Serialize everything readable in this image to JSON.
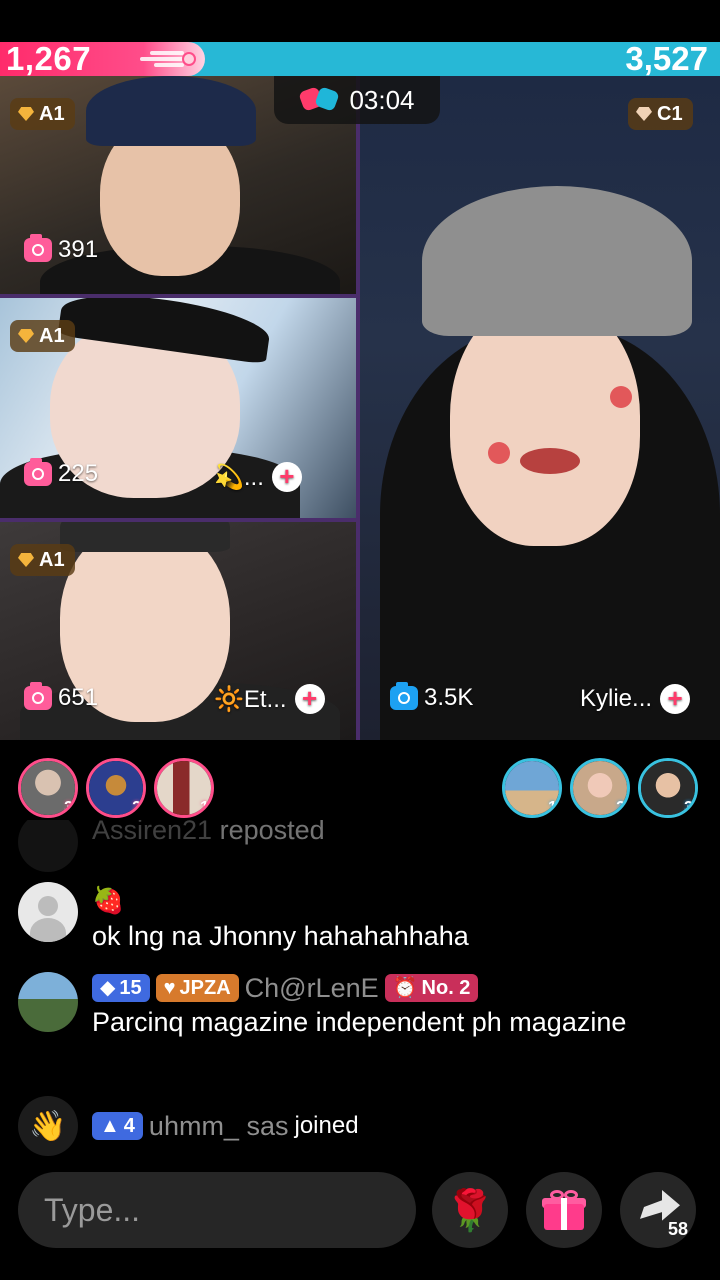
{
  "battle": {
    "left_score": "1,267",
    "right_score": "3,527",
    "left_color": "#ff3b6b",
    "right_color": "#27b8d6",
    "timer": "03:04"
  },
  "tiles": [
    {
      "rank": "A1",
      "count": "391",
      "name": ""
    },
    {
      "rank": "A1",
      "count": "225",
      "name": "💫..."
    },
    {
      "rank": "A1",
      "count": "651",
      "name": "🔆Et..."
    },
    {
      "rank": "C1",
      "count": "3.5K",
      "name": "Kylie..."
    }
  ],
  "supporters": {
    "left": [
      {
        "rank": "3"
      },
      {
        "rank": "2"
      },
      {
        "rank": "1"
      }
    ],
    "right": [
      {
        "rank": "1"
      },
      {
        "rank": "2"
      },
      {
        "rank": "3"
      }
    ]
  },
  "chat": {
    "partial": {
      "user": "Assiren21",
      "text": "reposted"
    },
    "messages": [
      {
        "emoji": "🍓",
        "text": "ok lng na Jhonny hahahahhaha"
      },
      {
        "level": "15",
        "fan_badge": "JPZA",
        "user": "Ch@rLenE",
        "rank_badge": "No. 2",
        "text": "Parcinq magazine independent ph magazine"
      }
    ],
    "join": {
      "level": "4",
      "user": "uhmm_ sas",
      "text": "joined"
    }
  },
  "bottom": {
    "placeholder": "Type...",
    "share_count": "58"
  },
  "icons": {
    "rank": "diamond-icon",
    "viewers": "camera-icon",
    "follow": "plus-icon",
    "battle": "gloves-icon",
    "rose": "rose-icon",
    "gift": "gift-icon",
    "share": "share-arrow-icon",
    "wave": "wave-hand-icon"
  }
}
